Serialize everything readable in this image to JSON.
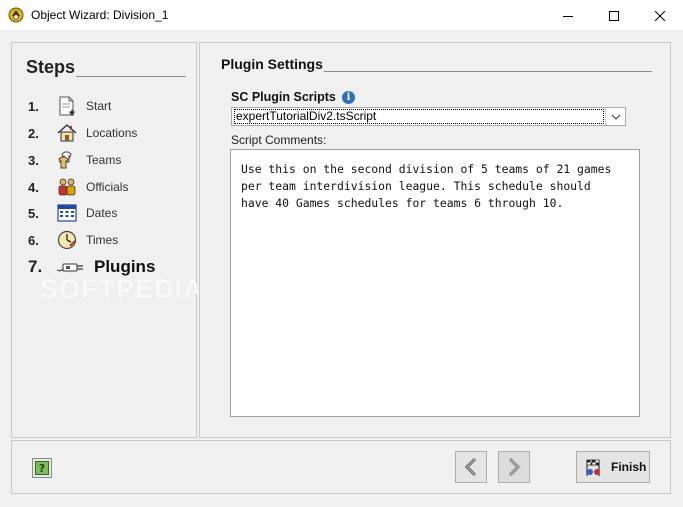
{
  "window": {
    "title": "Object Wizard: Division_1"
  },
  "steps": {
    "title": "Steps",
    "items": [
      {
        "num": "1.",
        "label": "Start",
        "icon": "document-star-icon"
      },
      {
        "num": "2.",
        "label": "Locations",
        "icon": "house-icon"
      },
      {
        "num": "3.",
        "label": "Teams",
        "icon": "shirts-icon"
      },
      {
        "num": "4.",
        "label": "Officials",
        "icon": "people-icon"
      },
      {
        "num": "5.",
        "label": "Dates",
        "icon": "calendar-icon"
      },
      {
        "num": "6.",
        "label": "Times",
        "icon": "clock-icon"
      },
      {
        "num": "7.",
        "label": "Plugins",
        "icon": "plug-icon",
        "active": true
      }
    ]
  },
  "watermark": "SOFTPEDIA",
  "plugin_settings": {
    "title": "Plugin Settings",
    "scripts_label": "SC Plugin Scripts",
    "selected_script": "expertTutorialDiv2.tsScript",
    "comments_label": "Script Comments:",
    "comments": "Use this on the second division of 5 teams of 21 games\nper team interdivision league. This schedule should\nhave 40 Games schedules for teams 6 through 10."
  },
  "footer": {
    "finish_label": "Finish"
  },
  "colors": {
    "background": "#f0f0f0",
    "panel_border": "#c8c8c8",
    "info_blue": "#2e6fc0"
  }
}
